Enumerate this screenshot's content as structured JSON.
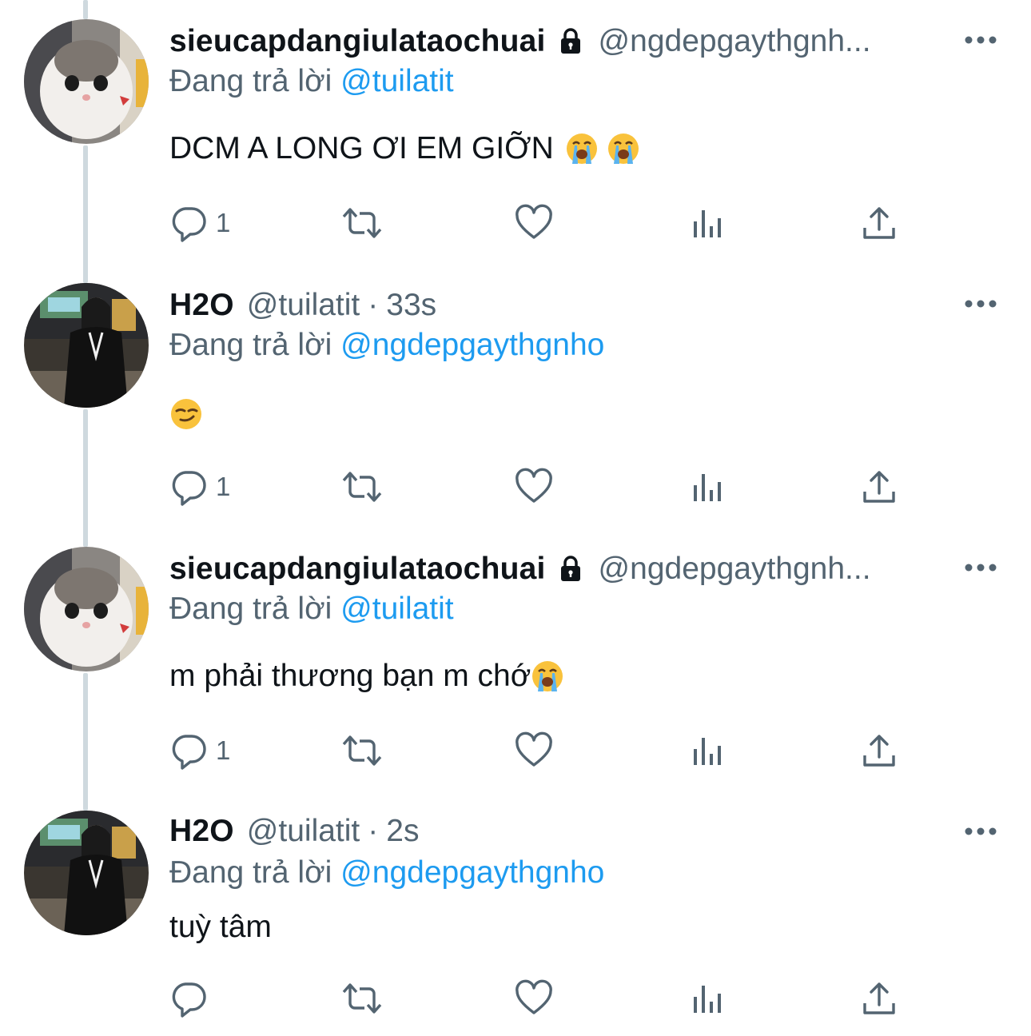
{
  "colors": {
    "text_primary": "#0f1419",
    "text_secondary": "#536471",
    "link": "#1d9bf0",
    "thread_line": "#cfd9de"
  },
  "tweets": [
    {
      "display_name": "sieucapdangiulataochuai",
      "protected": true,
      "handle": "@ngdepgaythgnh...",
      "time": "",
      "reply_prefix": "Đang trả lời",
      "reply_to": "@tuilatit",
      "text": "DCM A LONG ƠI EM GIỠN",
      "emojis": [
        "loudly-crying-face",
        "loudly-crying-face"
      ],
      "reply_count": "1",
      "avatar": "cat-avatar"
    },
    {
      "display_name": "H2O",
      "protected": false,
      "handle": "@tuilatit",
      "separator": "·",
      "time": "33s",
      "reply_prefix": "Đang trả lời",
      "reply_to": "@ngdepgaythgnho",
      "text": "",
      "emojis": [
        "smirking-face"
      ],
      "reply_count": "1",
      "avatar": "girl-avatar"
    },
    {
      "display_name": "sieucapdangiulataochuai",
      "protected": true,
      "handle": "@ngdepgaythgnh...",
      "time": "",
      "reply_prefix": "Đang trả lời",
      "reply_to": "@tuilatit",
      "text": "m phải thương bạn m chớ",
      "emojis": [
        "loudly-crying-face"
      ],
      "reply_count": "1",
      "avatar": "cat-avatar"
    },
    {
      "display_name": "H2O",
      "protected": false,
      "handle": "@tuilatit",
      "separator": "·",
      "time": "2s",
      "reply_prefix": "Đang trả lời",
      "reply_to": "@ngdepgaythgnho",
      "text": "tuỳ tâm",
      "emojis": [],
      "reply_count": "",
      "avatar": "girl-avatar"
    }
  ],
  "icons": {
    "reply": "reply-icon",
    "retweet": "retweet-icon",
    "like": "heart-icon",
    "views": "views-icon",
    "share": "share-icon",
    "more": "more-icon",
    "lock": "lock-icon"
  }
}
